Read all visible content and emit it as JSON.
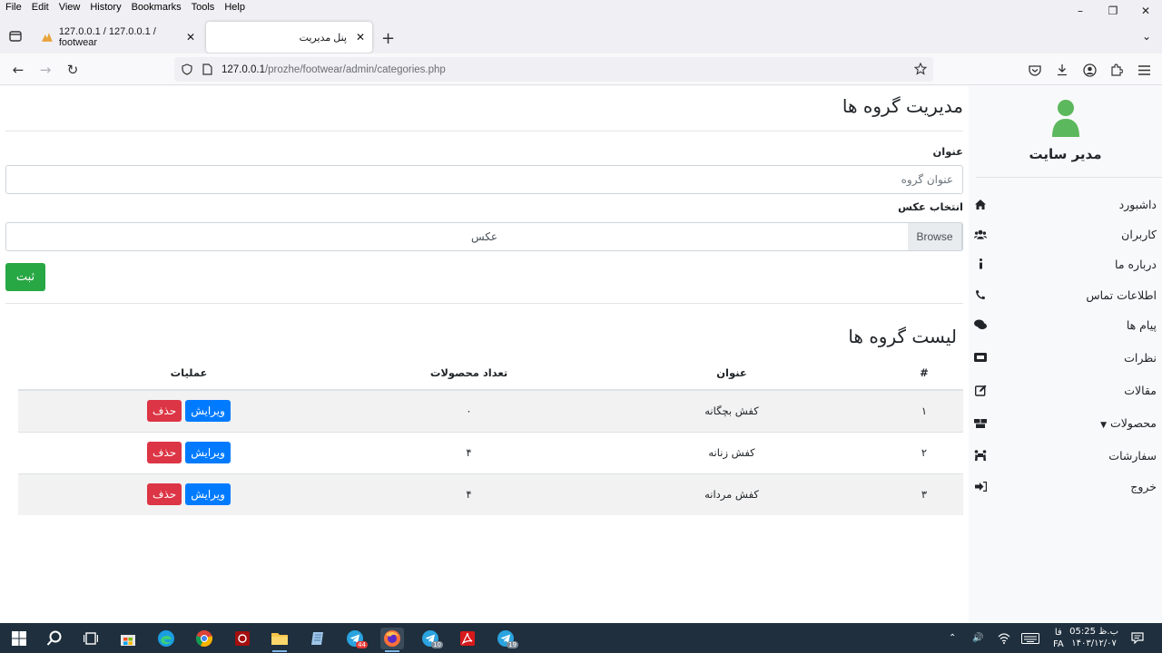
{
  "menu": [
    "File",
    "Edit",
    "View",
    "History",
    "Bookmarks",
    "Tools",
    "Help"
  ],
  "tabs": [
    {
      "title": "127.0.0.1 / 127.0.0.1 / footwear",
      "active": false
    },
    {
      "title": "پنل مدیریت",
      "active": true
    }
  ],
  "url": {
    "host": "127.0.0.1",
    "path": "/prozhe/footwear/admin/categories.php"
  },
  "sidebar": {
    "admin_name": "مدیر سایت",
    "items": [
      {
        "label": "داشبورد",
        "icon": "home-icon"
      },
      {
        "label": "کاربران",
        "icon": "users-icon"
      },
      {
        "label": "درباره ما",
        "icon": "info-icon"
      },
      {
        "label": "اطلاعات تماس",
        "icon": "phone-icon"
      },
      {
        "label": "پیام ها",
        "icon": "comments-icon"
      },
      {
        "label": "نظرات",
        "icon": "ticket-icon"
      },
      {
        "label": "مقالات",
        "icon": "edit-icon"
      },
      {
        "label": "محصولات",
        "icon": "boxes-icon",
        "dropdown": true
      },
      {
        "label": "سفارشات",
        "icon": "people-carry-icon"
      },
      {
        "label": "خروج",
        "icon": "sign-out-icon"
      }
    ]
  },
  "form": {
    "heading": "مدیریت گروه ها",
    "title_label": "عنوان",
    "title_placeholder": "عنوان گروه",
    "image_label": "انتخاب عکس",
    "file_placeholder": "عکس",
    "browse_label": "Browse",
    "submit_label": "ثبت"
  },
  "list": {
    "heading": "لیست گروه ها",
    "columns": [
      "#",
      "عنوان",
      "تعداد محصولات",
      "عملیات"
    ],
    "rows": [
      {
        "num": "۱",
        "title": "کفش بچگانه",
        "count": "۰"
      },
      {
        "num": "۲",
        "title": "کفش زنانه",
        "count": "۴"
      },
      {
        "num": "۳",
        "title": "کفش مردانه",
        "count": "۴"
      }
    ],
    "edit_label": "ویرایش",
    "delete_label": "حذف"
  },
  "taskbar": {
    "lang_top": "فا",
    "lang_bottom": "FA",
    "time": "05:25 ب.ظ",
    "date": "۱۴۰۳/۱۲/۰۷",
    "badges": [
      "44",
      "10",
      "19"
    ]
  },
  "colors": {
    "success": "#28a745",
    "primary": "#007bff",
    "danger": "#dc3545",
    "avatar": "#5cb85c"
  }
}
